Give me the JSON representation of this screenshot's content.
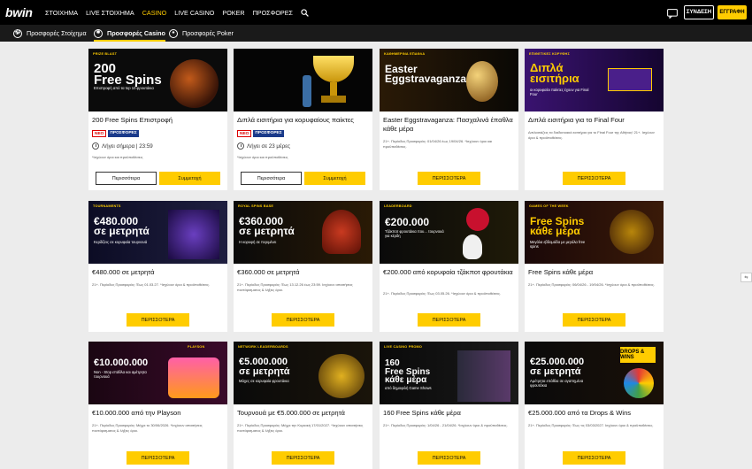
{
  "header": {
    "logo": "bwin",
    "nav": [
      "ΣΤΟΙΧΗΜΑ",
      "LIVE ΣΤΟΙΧΗΜΑ",
      "CASINO",
      "LIVE CASINO",
      "POKER",
      "ΠΡΟΣΦΟΡΕΣ"
    ],
    "active_nav": "CASINO",
    "login": "ΣΥΝΔΕΣΗ",
    "register": "ΕΓΓΡΑΦΗ"
  },
  "tabs": [
    "Προσφορές Στοίχημα",
    "Προσφορές Casino",
    "Προσφορές Poker"
  ],
  "colors": {
    "accent": "#ffcc00",
    "promo_badge": "#1a3a8a",
    "new_badge": "#dd0000"
  },
  "cards": [
    {
      "title": "200 Free Spins Επιστροφή",
      "badge_new": "ΝΕΟ",
      "badge_promo": "ΠΡΟΣΦΟΡΕΣ",
      "expiry": "Λήγει σήμερα | 23:59",
      "terms": "*Ισχύουν όροι και προϋποθέσεις",
      "btn_more": "Περισσότερα",
      "btn_join": "Συμμετοχή",
      "banner": {
        "tag": "PRIZE BLAST",
        "big": "200\nFree Spins",
        "small": "Επιστροφή από τα top 10 φρουτάκια",
        "bg": "#0b0b0b"
      }
    },
    {
      "title": "Διπλά εισιτήρια για κορυφαίους παίκτες",
      "badge_new": "ΝΕΟ",
      "badge_promo": "ΠΡΟΣΦΟΡΕΣ",
      "expiry": "Λήγει σε 23 μέρες",
      "terms": "*Ισχύουν όροι και προϋποθέσεις",
      "btn_more": "Περισσότερα",
      "btn_join": "Συμμετοχή",
      "banner": {
        "tag": "",
        "big": "",
        "small": "",
        "bg": "#050505"
      }
    },
    {
      "title": "Easter Eggstravaganza: Πασχαλινά έπαθλα κάθε μέρα",
      "terms": "21+. Περίοδος Προσφοράς: 01/04/26 έως 19/04/26. *Ισχύουν όροι και προϋποθέσεις.",
      "button": "ΠΕΡΙΣΣΟΤΕΡΑ",
      "banner": {
        "tag": "ΚΑΘΗΜΕΡΙΝΑ ΕΠΑΘΛΑ",
        "big": "Easter\nEggstravaganza",
        "small": "",
        "bg": "#1c160a"
      }
    },
    {
      "title": "Διπλά εισιτήρια για το Final Four",
      "terms": "Διπλασιάζεις τα διαδικτυακά εισιτήρια για το Final Four της Αθήνας! 21+. Ισχύουν όροι & προϋποθέσεις.",
      "button": "ΠΕΡΙΣΣΟΤΕΡΑ",
      "banner": {
        "tag": "ΕΠΙΘΕΤΙΚΕΣ ΚΟΡΥΦΗΣ",
        "big": "Διπλά\nεισιτήρια",
        "small": "οι κορυφαίοι παίκτες έχουν για Final Four",
        "bg": "#2a0e4a"
      }
    },
    {
      "title": "€480.000 σε μετρητά",
      "terms": "21+. Περίοδος Προσφοράς: Έως 01.03.27. *Ισχύουν όροι & προϋποθέσεις.",
      "button": "ΠΕΡΙΣΣΟΤΕΡΑ",
      "banner": {
        "tag": "TOURNAMENTS",
        "big": "€480.000\nσε μετρητά",
        "small": "Κερδίζεις σε κορυφαία τουρνουά",
        "bg": "#0a0a1a"
      }
    },
    {
      "title": "€360.000 σε μετρητά",
      "terms": "21+. Περίοδος Προσφοράς: Έως 13.12.26 έως 23:59. Ισχύουν απαιτήσεις ποντάρισματος & λήξεις όροι.",
      "button": "ΠΕΡΙΣΣΟΤΕΡΑ",
      "banner": {
        "tag": "ROYAL SPINS BASE",
        "big": "€360.000\nσε μετρητά",
        "small": "Η κορυφή σε περιμένει",
        "bg": "#0a0a0a"
      }
    },
    {
      "title": "€200.000 από κορυφαία τζάκποτ φρουτάκια",
      "terms": "21+. Περίοδος Προσφοράς: Έως 03.05.26. *Ισχύουν όροι & προϋποθέσεις.",
      "button": "ΠΕΡΙΣΣΟΤΕΡΑ",
      "banner": {
        "tag": "LEADERBOARD",
        "big": "€200.000",
        "small": "Τζάκποτ φρουτάκια που... τουρνουά για κέρδη",
        "bg": "#0a0a0a"
      }
    },
    {
      "title": "Free Spins κάθε μέρα",
      "terms": "21+. Περίοδος Προσφοράς: 06/04/26 - 19/04/26. *Ισχύουν όροι & προϋποθέσεις.",
      "button": "ΠΕΡΙΣΣΟΤΕΡΑ",
      "banner": {
        "tag": "GAMES OF THE WEEK",
        "big": "Free Spins\nκάθε μέρα",
        "small": "Μεγάλα εβδομάδα με μεγάλα free spins",
        "bg": "#1a0808"
      }
    },
    {
      "title": "€10.000.000 από την Playson",
      "terms": "21+. Περίοδος Προσφοράς: Μέχρι το 30/06/2026. *Ισχύουν απαιτήσεις ποντάρισματος & λήξεις όροι.",
      "button": "ΠΕΡΙΣΣΟΤΕΡΑ",
      "banner": {
        "tag": "PLAYSON",
        "big": "€10.000.000",
        "small": "Non - Stop επάθλα και αμέτρητα τουρνουά",
        "bg": "#1a0a14"
      }
    },
    {
      "title": "Τουρνουά με €5.000.000 σε μετρητά",
      "terms": "21+. Περίοδος Προσφοράς: Μέχρι την Κυριακή 17/01/2027. *Ισχύουν απαιτήσεις ποντάρισματος & λήξεις όροι.",
      "button": "ΠΕΡΙΣΣΟΤΕΡΑ",
      "banner": {
        "tag": "NETWORK LEADERBOARDS",
        "big": "€5.000.000\nσε μετρητά",
        "small": "Μάχες σε κορυφαία φρουτάκια",
        "bg": "#0a0a0a"
      }
    },
    {
      "title": "160 Free Spins κάθε μέρα",
      "terms": "21+. Περίοδος Προσφοράς: 1/04/26 - 21/04/26. *Ισχύουν όροι & προϋποθέσεις.",
      "button": "ΠΕΡΙΣΣΟΤΕΡΑ",
      "banner": {
        "tag": "LIVE CASINO PROMO",
        "big": "160\nFree Spins\nκάθε μέρα",
        "small": "από δημοφιλή Game Shows",
        "bg": "#0a0a0a"
      }
    },
    {
      "title": "€25.000.000 από τα Drops & Wins",
      "terms": "21+. Περίοδος Προσφοράς: Έως τις 03/03/2027. Ισχύουν όροι & προϋποθέσεις.",
      "button": "ΠΕΡΙΣΣΟΤΕΡΑ",
      "banner": {
        "tag": "",
        "big": "€25.000.000\nσε μετρητά",
        "small": "Αμέτρητα επάθλα σε αγαπημένα φρουτάκια",
        "bg": "#0a0a0a"
      }
    }
  ]
}
